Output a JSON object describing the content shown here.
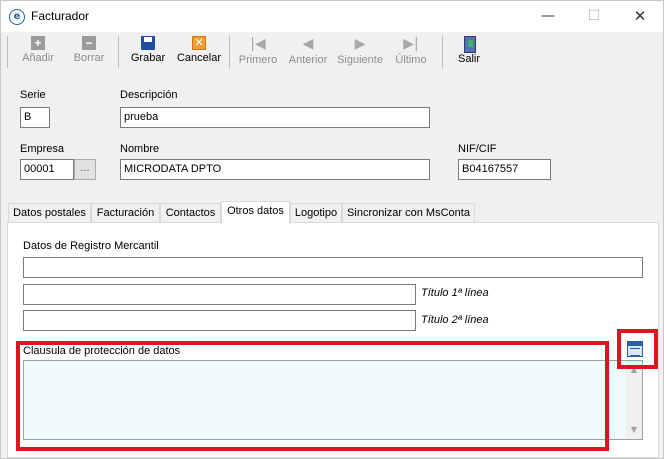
{
  "window": {
    "title": "Facturador",
    "controls": {
      "minimize": "—",
      "maximize": "☐",
      "close": "✕"
    }
  },
  "toolbar": {
    "buttons": [
      {
        "label": "Añadir",
        "icon": "add-icon",
        "enabled": false
      },
      {
        "label": "Borrar",
        "icon": "delete-icon",
        "enabled": false
      },
      {
        "label": "Grabar",
        "icon": "save-icon",
        "enabled": true
      },
      {
        "label": "Cancelar",
        "icon": "cancel-icon",
        "enabled": true
      },
      {
        "label": "Primero",
        "icon": "first-icon",
        "enabled": false
      },
      {
        "label": "Anterior",
        "icon": "previous-icon",
        "enabled": false
      },
      {
        "label": "Siguiente",
        "icon": "next-icon",
        "enabled": false
      },
      {
        "label": "Último",
        "icon": "last-icon",
        "enabled": false
      },
      {
        "label": "Salir",
        "icon": "exit-icon",
        "enabled": true
      }
    ],
    "glyphs": {
      "add": "+",
      "delete": "−",
      "cancel": "✕",
      "first": "|◀",
      "previous": "◀",
      "next": "▶",
      "last": "▶|"
    }
  },
  "form": {
    "serie": {
      "label": "Serie",
      "value": "B"
    },
    "descripcion": {
      "label": "Descripción",
      "value": "prueba"
    },
    "empresa": {
      "label": "Empresa",
      "value": "00001",
      "button": "..."
    },
    "nombre": {
      "label": "Nombre",
      "value": "MICRODATA DPTO"
    },
    "nif": {
      "label": "NIF/CIF",
      "value": "B04167557"
    }
  },
  "tabs": [
    {
      "label": "Datos postales",
      "active": false
    },
    {
      "label": "Facturación",
      "active": false
    },
    {
      "label": "Contactos",
      "active": false
    },
    {
      "label": "Otros datos",
      "active": true
    },
    {
      "label": "Logotipo",
      "active": false
    },
    {
      "label": "Sincronizar con MsConta",
      "active": false
    }
  ],
  "otros_datos": {
    "registro_label": "Datos de Registro Mercantil",
    "registro_value": "",
    "titulo1_value": "",
    "titulo1_label": "Título  1ª línea",
    "titulo2_value": "",
    "titulo2_label": "Título  2ª línea",
    "clausula_label": "Clausula de protección de datos",
    "clausula_value": "",
    "scroll_up": "▲",
    "scroll_down": "▼"
  },
  "colors": {
    "highlight": "#e3121f",
    "textarea_bg": "#f0fafc"
  }
}
